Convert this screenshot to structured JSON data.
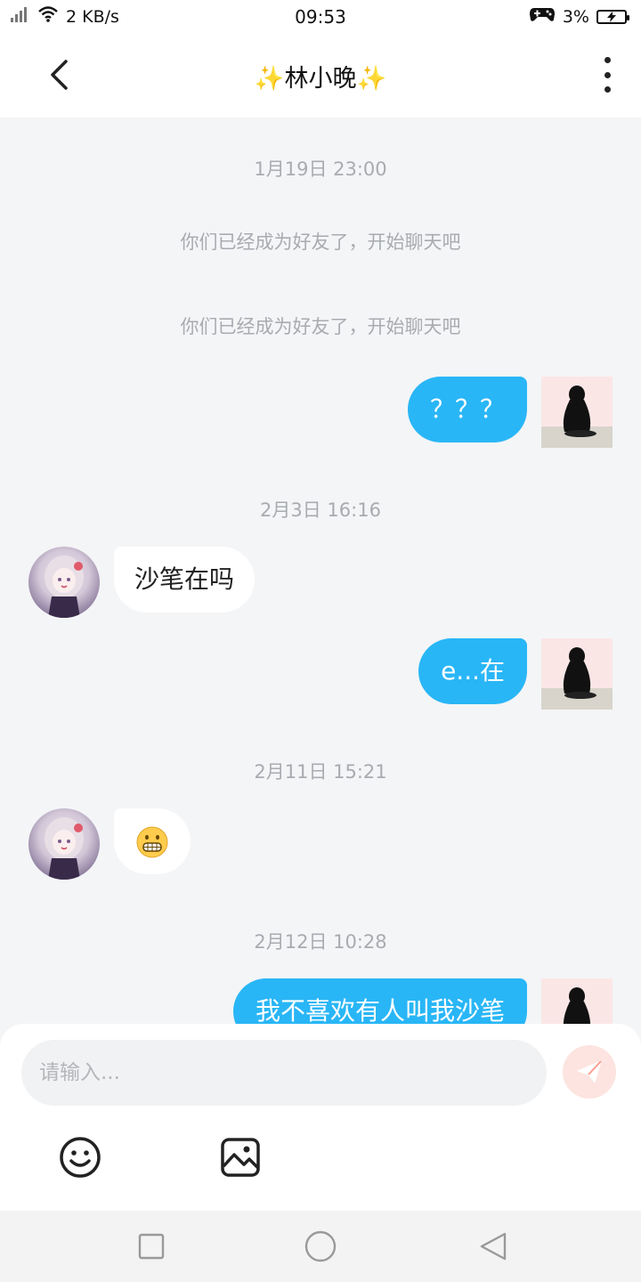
{
  "status_bar": {
    "network_speed": "2 KB/s",
    "time": "09:53",
    "battery_percent": "3%",
    "icons": [
      "signal-icon",
      "wifi-icon",
      "gamepad-icon",
      "battery-charging-icon"
    ]
  },
  "header": {
    "title": "✨林小晚✨",
    "back_icon": "chevron-left-icon",
    "more_icon": "more-vertical-icon"
  },
  "chat": {
    "timestamps": [
      "1月19日 23:00",
      "2月3日 16:16",
      "2月11日 15:21",
      "2月12日 10:28"
    ],
    "system_messages": [
      "你们已经成为好友了，开始聊天吧",
      "你们已经成为好友了，开始聊天吧"
    ],
    "messages": [
      {
        "side": "self",
        "text": "？？？"
      },
      {
        "side": "peer",
        "text": "沙笔在吗"
      },
      {
        "side": "self",
        "text": "e...在"
      },
      {
        "side": "peer",
        "text": "😁"
      },
      {
        "side": "self",
        "text": "我不喜欢有人叫我沙笔"
      }
    ]
  },
  "input_panel": {
    "placeholder": "请输入...",
    "icons": [
      "send-icon",
      "emoji-icon",
      "image-icon"
    ]
  },
  "nav_bar": {
    "icons": [
      "recent-apps-icon",
      "home-icon",
      "back-icon"
    ]
  },
  "colors": {
    "outgoing_bubble": "#29b6f6",
    "incoming_bubble": "#ffffff",
    "chat_background": "#f4f5f7",
    "send_button_bg": "#fde4e0",
    "send_icon": "#ff8a80"
  }
}
